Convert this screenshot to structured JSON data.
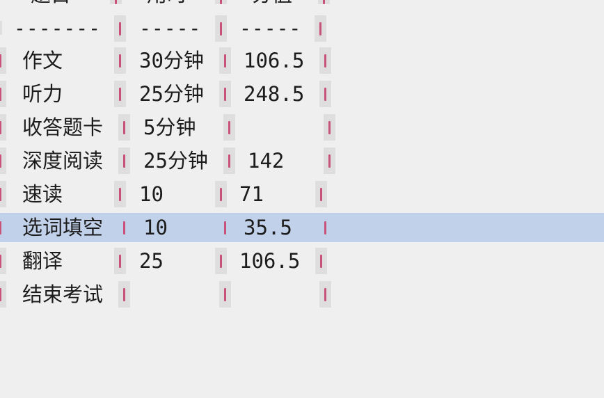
{
  "table": {
    "header": [
      "题目",
      "用时",
      "分值"
    ],
    "separators": [
      "-------",
      "-----",
      "-----"
    ],
    "rows": [
      [
        "作文",
        "30分钟",
        "106.5"
      ],
      [
        "听力",
        "25分钟",
        "248.5"
      ],
      [
        "收答题卡",
        "5分钟",
        ""
      ],
      [
        "深度阅读",
        "25分钟",
        "142"
      ],
      [
        "速读",
        "10",
        "71"
      ],
      [
        "选词填空",
        "10",
        "35.5"
      ],
      [
        "翻译",
        "25",
        "106.5"
      ],
      [
        "结束考试",
        "",
        ""
      ]
    ],
    "selected_row": 5
  },
  "colors": {
    "background": "#efefef",
    "selection": "#c2d1ea",
    "pipe": "#c8527a",
    "pipe_bg": "#dedede"
  }
}
